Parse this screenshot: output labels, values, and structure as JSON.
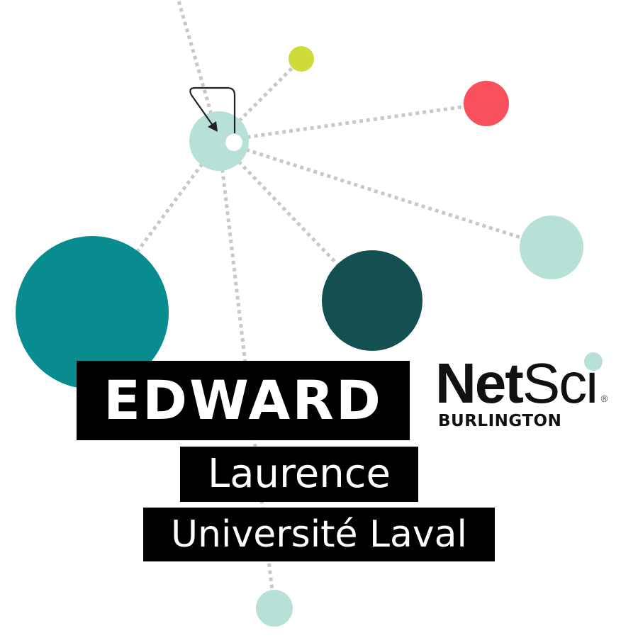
{
  "colors": {
    "background": "#ffffff",
    "edge": "#c8c8c8",
    "loop_arrow": "#222222",
    "label_background": "#000000",
    "label_text": "#ffffff",
    "mint": "#b7e0d6",
    "lime": "#cddc3a",
    "coral": "#f8505c",
    "teal": "#088c8f",
    "dark_teal": "#145052",
    "hole": "#ffffff"
  },
  "network": {
    "nodes": [
      {
        "id": "hub",
        "color": "mint",
        "size": "medium"
      },
      {
        "id": "lime",
        "color": "lime",
        "size": "small"
      },
      {
        "id": "coral",
        "color": "coral",
        "size": "small"
      },
      {
        "id": "mint-right",
        "color": "mint",
        "size": "medium"
      },
      {
        "id": "dark-teal",
        "color": "dark_teal",
        "size": "large"
      },
      {
        "id": "teal",
        "color": "teal",
        "size": "extra-large"
      },
      {
        "id": "mint-bottom",
        "color": "mint",
        "size": "small"
      }
    ],
    "edges": [
      {
        "from": "hub",
        "to": "top-edge"
      },
      {
        "from": "hub",
        "to": "lime"
      },
      {
        "from": "hub",
        "to": "coral"
      },
      {
        "from": "hub",
        "to": "mint-right"
      },
      {
        "from": "hub",
        "to": "dark-teal"
      },
      {
        "from": "hub",
        "to": "teal"
      },
      {
        "from": "hub",
        "to": "mint-bottom"
      }
    ],
    "self_loop": {
      "node": "hub",
      "arrow": "self-loop-arrow-icon"
    }
  },
  "person": {
    "surname": "EDWARD",
    "first_name": "Laurence",
    "affiliation": "Université Laval"
  },
  "logo": {
    "net": "Net",
    "sci": "Sci",
    "subtitle": "BURLINGTON",
    "registered": "®",
    "dot_color": "#b7e0d6",
    "text_color": "#111111"
  }
}
